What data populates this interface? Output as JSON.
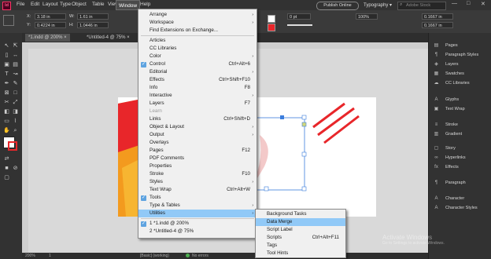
{
  "menubar": {
    "logo": "Id",
    "items": [
      "File",
      "Edit",
      "Layout",
      "Type",
      "Object",
      "Table",
      "View",
      "Window",
      "Help"
    ],
    "active": "Window",
    "publish_button": "Publish Online",
    "workspace": "Typography",
    "search_placeholder": "Adobe Stock"
  },
  "control": {
    "x_label": "X:",
    "x_value": "3.18 in",
    "y_label": "Y:",
    "y_value": "0.4224 in",
    "w_label": "W:",
    "w_value": "1.61 in",
    "h_label": "H:",
    "h_value": "1.0446 in",
    "stroke_weight": "0 pt",
    "right_value_1": "0.1667 in",
    "right_value_2": "0.1667 in",
    "percent_value": "100%"
  },
  "tabs": [
    "*1.indd @ 200%",
    "*Untitled-4 @ 75%"
  ],
  "window_menu": {
    "items": [
      {
        "label": "Arrange",
        "shortcut": "",
        "submenu": true,
        "checked": false,
        "disabled": false
      },
      {
        "label": "Workspace",
        "shortcut": "",
        "submenu": true,
        "checked": false,
        "disabled": false
      },
      {
        "label": "Find Extensions on Exchange...",
        "shortcut": "",
        "submenu": false,
        "checked": false,
        "disabled": false
      },
      {
        "label": "Articles",
        "shortcut": "",
        "submenu": false,
        "checked": false,
        "disabled": false
      },
      {
        "label": "CC Libraries",
        "shortcut": "",
        "submenu": false,
        "checked": false,
        "disabled": false
      },
      {
        "label": "Color",
        "shortcut": "",
        "submenu": true,
        "checked": false,
        "disabled": false
      },
      {
        "label": "Control",
        "shortcut": "Ctrl+Alt+6",
        "submenu": false,
        "checked": true,
        "disabled": false
      },
      {
        "label": "Editorial",
        "shortcut": "",
        "submenu": true,
        "checked": false,
        "disabled": false
      },
      {
        "label": "Effects",
        "shortcut": "Ctrl+Shift+F10",
        "submenu": false,
        "checked": false,
        "disabled": false
      },
      {
        "label": "Info",
        "shortcut": "F8",
        "submenu": false,
        "checked": false,
        "disabled": false
      },
      {
        "label": "Interactive",
        "shortcut": "",
        "submenu": true,
        "checked": false,
        "disabled": false
      },
      {
        "label": "Layers",
        "shortcut": "F7",
        "submenu": false,
        "checked": false,
        "disabled": false
      },
      {
        "label": "Learn",
        "shortcut": "",
        "submenu": false,
        "checked": false,
        "disabled": true
      },
      {
        "label": "Links",
        "shortcut": "Ctrl+Shift+D",
        "submenu": false,
        "checked": false,
        "disabled": false
      },
      {
        "label": "Object & Layout",
        "shortcut": "",
        "submenu": true,
        "checked": false,
        "disabled": false
      },
      {
        "label": "Output",
        "shortcut": "",
        "submenu": true,
        "checked": false,
        "disabled": false
      },
      {
        "label": "Overlays",
        "shortcut": "",
        "submenu": false,
        "checked": false,
        "disabled": false
      },
      {
        "label": "Pages",
        "shortcut": "F12",
        "submenu": false,
        "checked": false,
        "disabled": false
      },
      {
        "label": "PDF Comments",
        "shortcut": "",
        "submenu": false,
        "checked": false,
        "disabled": false
      },
      {
        "label": "Properties",
        "shortcut": "",
        "submenu": false,
        "checked": false,
        "disabled": false
      },
      {
        "label": "Stroke",
        "shortcut": "F10",
        "submenu": false,
        "checked": false,
        "disabled": false
      },
      {
        "label": "Styles",
        "shortcut": "",
        "submenu": true,
        "checked": false,
        "disabled": false
      },
      {
        "label": "Text Wrap",
        "shortcut": "Ctrl+Alt+W",
        "submenu": false,
        "checked": false,
        "disabled": false
      },
      {
        "label": "Tools",
        "shortcut": "",
        "submenu": false,
        "checked": true,
        "disabled": false
      },
      {
        "label": "Type & Tables",
        "shortcut": "",
        "submenu": true,
        "checked": false,
        "disabled": false
      },
      {
        "label": "Utilities",
        "shortcut": "",
        "submenu": true,
        "checked": false,
        "disabled": false,
        "highlighted": true
      },
      {
        "label": "1 *1.indd @ 200%",
        "shortcut": "",
        "submenu": false,
        "checked": true,
        "disabled": false
      },
      {
        "label": "2 *Untitled-4 @ 75%",
        "shortcut": "",
        "submenu": false,
        "checked": false,
        "disabled": false
      }
    ]
  },
  "utilities_menu": {
    "items": [
      {
        "label": "Background Tasks",
        "shortcut": ""
      },
      {
        "label": "Data Merge",
        "shortcut": "",
        "highlighted": true
      },
      {
        "label": "Script Label",
        "shortcut": ""
      },
      {
        "label": "Scripts",
        "shortcut": "Ctrl+Alt+F11"
      },
      {
        "label": "Tags",
        "shortcut": ""
      },
      {
        "label": "Tool Hints",
        "shortcut": ""
      }
    ]
  },
  "panels": [
    {
      "label": "Pages",
      "icon": "pages-icon",
      "glyph": "▤"
    },
    {
      "label": "Paragraph Styles",
      "icon": "paragraph-styles-icon",
      "glyph": "¶"
    },
    {
      "label": "Layers",
      "icon": "layers-icon",
      "glyph": "◈"
    },
    {
      "label": "Swatches",
      "icon": "swatches-icon",
      "glyph": "▦"
    },
    {
      "label": "CC Libraries",
      "icon": "cc-libraries-icon",
      "glyph": "☁"
    },
    {
      "label": "Glyphs",
      "icon": "glyphs-icon",
      "glyph": "A"
    },
    {
      "label": "Text Wrap",
      "icon": "text-wrap-icon",
      "glyph": "▣"
    },
    {
      "label": "Stroke",
      "icon": "stroke-icon",
      "glyph": "≡"
    },
    {
      "label": "Gradient",
      "icon": "gradient-icon",
      "glyph": "▥"
    },
    {
      "label": "Story",
      "icon": "story-icon",
      "glyph": "▢"
    },
    {
      "label": "Hyperlinks",
      "icon": "hyperlinks-icon",
      "glyph": "∞"
    },
    {
      "label": "Effects",
      "icon": "effects-icon",
      "glyph": "fx"
    },
    {
      "label": "Paragraph",
      "icon": "paragraph-icon",
      "glyph": "¶"
    },
    {
      "label": "Character",
      "icon": "character-icon",
      "glyph": "A"
    },
    {
      "label": "Character Styles",
      "icon": "character-styles-icon",
      "glyph": "A"
    }
  ],
  "watermark": {
    "line1": "Activate Windows",
    "line2": "Go to Settings to activate Windows."
  },
  "status": {
    "zoom": "200%",
    "page": "1",
    "master": "[Basic] (working)",
    "errors": "No errors"
  },
  "colors": {
    "accent": "#91c9f7",
    "check": "#5ea3e0",
    "ui_dark": "#323232",
    "artwork_red": "#e8262a",
    "artwork_orange": "#f39a1e"
  }
}
